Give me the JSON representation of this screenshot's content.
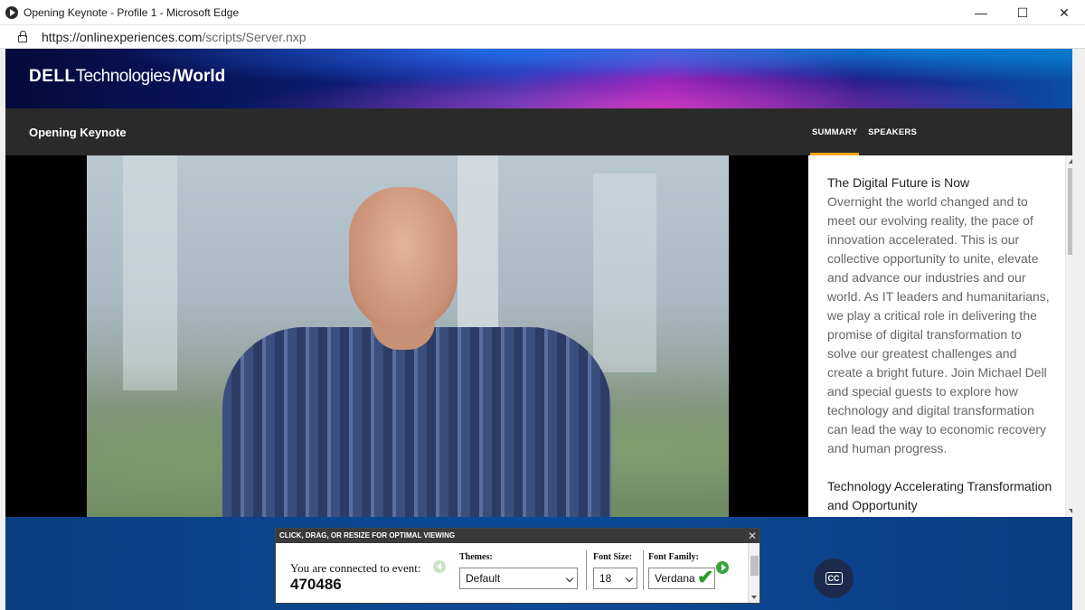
{
  "window": {
    "title": "Opening Keynote - Profile 1 - Microsoft Edge",
    "minimize": "—",
    "maximize": "☐",
    "close": "✕"
  },
  "address": {
    "host": "https://onlinexperiences.com",
    "path": "/scripts/Server.nxp"
  },
  "brand": {
    "dell": "DELL",
    "technologies": "Technologies",
    "world": "/World"
  },
  "header": {
    "event_title": "Opening Keynote",
    "tabs": [
      {
        "label": "SUMMARY",
        "active": true
      },
      {
        "label": "SPEAKERS",
        "active": false
      }
    ]
  },
  "summary": {
    "sections": [
      {
        "heading": "The Digital Future is Now",
        "body": "Overnight the world changed and to meet our evolving reality, the pace of innovation accelerated. This is our collective opportunity to unite, elevate and advance our industries and our world. As IT leaders and humanitarians, we play a critical role in delivering the promise of digital transformation to solve our greatest challenges and create a bright future. Join Michael Dell and special guests to explore how technology and digital transformation can lead the way to economic recovery and human progress."
      },
      {
        "heading": "Technology Accelerating Transformation and Opportunity",
        "body": ""
      }
    ]
  },
  "caption_widget": {
    "header": "CLICK, DRAG, OR RESIZE FOR OPTIMAL VIEWING",
    "close": "✕",
    "connected_text": "You are connected to event:",
    "event_id": "470486",
    "themes_label": "Themes:",
    "themes_value": "Default",
    "font_size_label": "Font Size:",
    "font_size_value": "18",
    "font_family_label": "Font Family:",
    "font_family_value": "Verdana",
    "check": "✔"
  },
  "cc_button": {
    "label": "CC"
  },
  "colors": {
    "accent_tab": "#f0a500",
    "footer_blue": "#0d4a96",
    "header_dark": "#2a2a2a"
  }
}
